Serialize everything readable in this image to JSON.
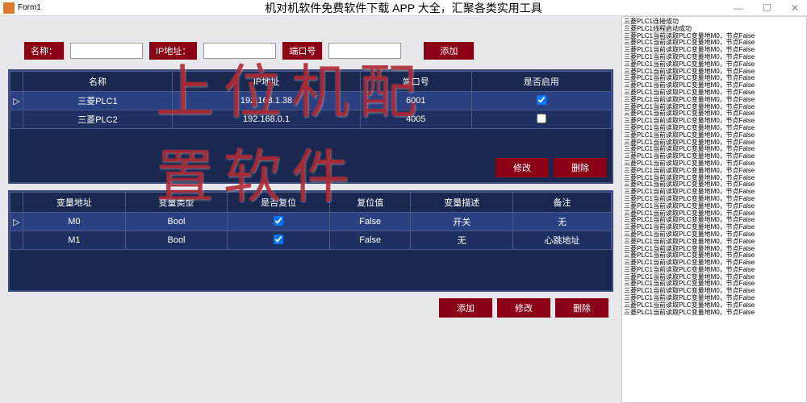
{
  "window": {
    "title": "Form1"
  },
  "page_title": "机对机软件免费软件下载 APP 大全，汇聚各类实用工具",
  "watermark": "上位机配置软件",
  "inputs": {
    "name_label": "名称：",
    "ip_label": "IP地址：",
    "port_label": "端口号",
    "add_button": "添加"
  },
  "table1": {
    "headers": {
      "name": "名称",
      "ip": "IP地址",
      "port": "端口号",
      "enabled": "是否启用"
    },
    "rows": [
      {
        "name": "三菱PLC1",
        "ip": "192.168.1.38",
        "port": "6001",
        "enabled": true
      },
      {
        "name": "三菱PLC2",
        "ip": "192.168.0.1",
        "port": "4005",
        "enabled": false
      }
    ],
    "buttons": {
      "modify": "修改",
      "delete": "删除"
    }
  },
  "table2": {
    "headers": {
      "addr": "变量地址",
      "type": "变量类型",
      "reset": "是否复位",
      "resetval": "复位值",
      "desc": "变量描述",
      "note": "备注"
    },
    "rows": [
      {
        "addr": "M0",
        "type": "Bool",
        "reset": true,
        "resetval": "False",
        "desc": "开关",
        "note": "无"
      },
      {
        "addr": "M1",
        "type": "Bool",
        "reset": true,
        "resetval": "False",
        "desc": "无",
        "note": "心跳地址"
      }
    ],
    "buttons": {
      "add": "添加",
      "modify": "修改",
      "delete": "删除"
    }
  },
  "log": {
    "line1": "三菱PLC1连接成功",
    "line2": "三菱PLC1线程启动成功",
    "repeat": "三菱PLC1当前读取PLC变量地M0，节点False"
  }
}
